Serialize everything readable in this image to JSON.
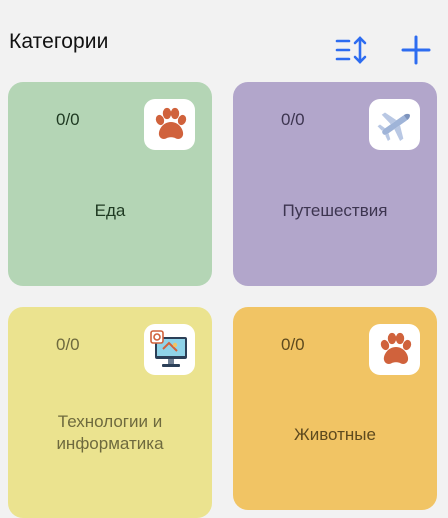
{
  "header": {
    "title": "Категории",
    "accent_color": "#2d6cf0",
    "sort_icon": "sort-icon",
    "add_icon": "plus-icon"
  },
  "categories": [
    {
      "count": "0/0",
      "name": "Еда",
      "icon": "paw-icon",
      "color": "#b4d5b5"
    },
    {
      "count": "0/0",
      "name": "Путешествия",
      "icon": "airplane-icon",
      "color": "#b2a6cb"
    },
    {
      "count": "0/0",
      "name": "Технологии и информатика",
      "icon": "computer-icon",
      "color": "#ebe38f"
    },
    {
      "count": "0/0",
      "name": "Животные",
      "icon": "paw-icon",
      "color": "#f1c464"
    }
  ]
}
